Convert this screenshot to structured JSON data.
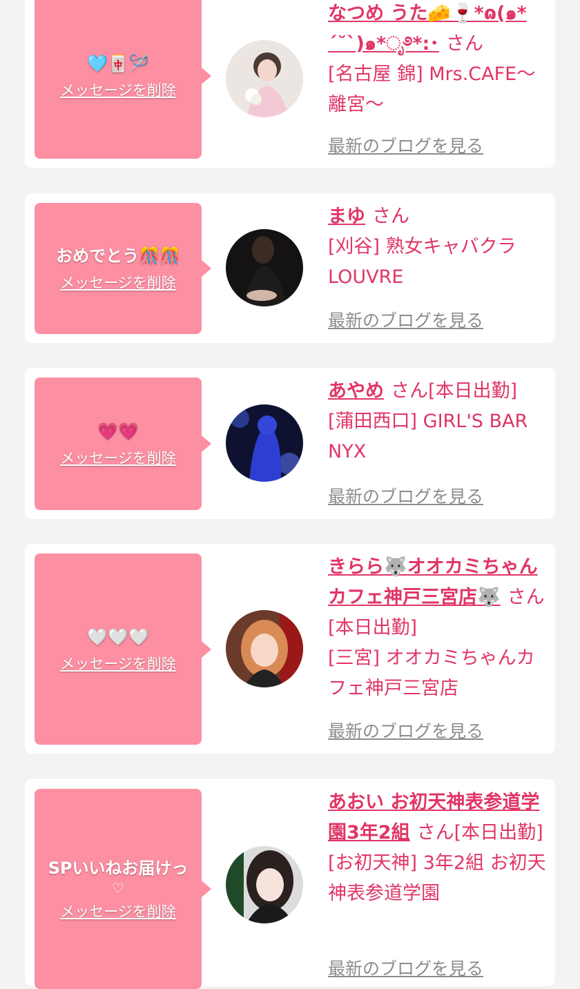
{
  "delete_label": "メッセージを削除",
  "blog_label": "最新のブログを見る",
  "san_label": "さん",
  "cards": [
    {
      "message": "🩵🀄🪡",
      "message_sub": "",
      "name": "なつめ うた🧀🍷*ɷ(๑*´˘`)๑*ೃ࿔*:･",
      "status": "",
      "shop": "[名古屋 錦] Mrs.CAFE〜離宮〜"
    },
    {
      "message": "おめでとう🎊🎊",
      "message_sub": "",
      "name": "まゆ",
      "status": "",
      "shop": "[刈谷] 熟女キャバクラ LOUVRE"
    },
    {
      "message": "💗💗",
      "message_sub": "",
      "name": "あやめ",
      "status": "[本日出勤]",
      "shop": "[蒲田西口] GIRL'S BAR NYX"
    },
    {
      "message": "🤍🤍🤍",
      "message_sub": "",
      "name": "きらら🐺オオカミちゃんカフェ神戸三宮店🐺",
      "status": "[本日出勤]",
      "shop": "[三宮] オオカミちゃんカフェ神戸三宮店"
    },
    {
      "message": "SPいいねお届けっ",
      "message_sub": "♡",
      "name": "あおい お初天神表参道学園3年2組",
      "status": "[本日出勤]",
      "shop": "[お初天神] 3年2組 お初天神表参道学園"
    }
  ]
}
